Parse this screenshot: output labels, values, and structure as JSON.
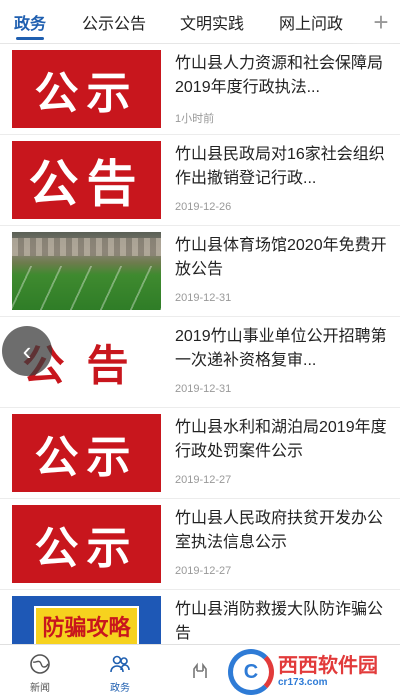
{
  "tabs": [
    {
      "label": "政务",
      "active": true
    },
    {
      "label": "公示公告",
      "active": false
    },
    {
      "label": "文明实践",
      "active": false
    },
    {
      "label": "网上问政",
      "active": false
    }
  ],
  "tab_add_glyph": "+",
  "news": [
    {
      "title": "竹山县人力资源和社会保障局2019年度行政执法...",
      "date": "1小时前",
      "thumb_text": "公示"
    },
    {
      "title": "竹山县民政局对16家社会组织作出撤销登记行政...",
      "date": "2019-12-26",
      "thumb_text": "公告"
    },
    {
      "title": "竹山县体育场馆2020年免费开放公告",
      "date": "2019-12-31",
      "thumb_text": ""
    },
    {
      "title": "2019竹山事业单位公开招聘第一次递补资格复审...",
      "date": "2019-12-31",
      "thumb_text": "公告"
    },
    {
      "title": "竹山县水利和湖泊局2019年度行政处罚案件公示",
      "date": "2019-12-27",
      "thumb_text": "公示"
    },
    {
      "title": "竹山县人民政府扶贫开发办公室执法信息公示",
      "date": "2019-12-27",
      "thumb_text": "公示"
    },
    {
      "title": "竹山县消防救援大队防诈骗公告",
      "date": "",
      "thumb_text": "防骗攻略"
    }
  ],
  "float_back_glyph": "‹",
  "bottom_nav": [
    {
      "label": "新闻",
      "icon": "globe-icon",
      "active": false
    },
    {
      "label": "政务",
      "icon": "people-icon",
      "active": true
    },
    {
      "label": "",
      "icon": "hands-icon",
      "active": false
    },
    {
      "label": "",
      "icon": "service-icon",
      "active": false
    },
    {
      "label": "",
      "icon": "user-icon",
      "active": false
    }
  ],
  "watermark": {
    "logo": "西西软件园",
    "url": "cr173.com",
    "mark": "C"
  },
  "colors": {
    "accent": "#1f5fb0",
    "notice_red": "#c8161d"
  }
}
